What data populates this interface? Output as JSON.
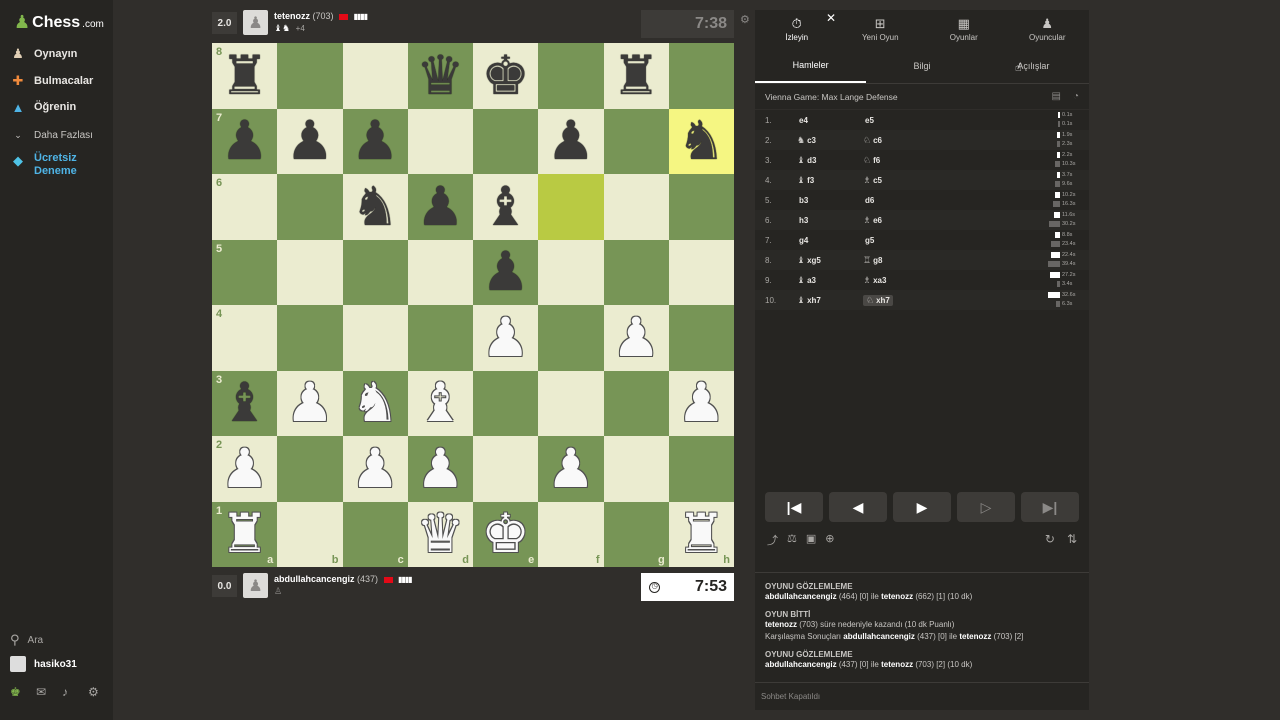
{
  "sidebar": {
    "logo_text": "Chess",
    "logo_domain": ".com",
    "items": [
      {
        "label": "Oynayın"
      },
      {
        "label": "Bulmacalar"
      },
      {
        "label": "Öğrenin"
      },
      {
        "label": "Daha Fazlası"
      },
      {
        "label": "Ücretsiz Deneme"
      }
    ],
    "search_label": "Ara",
    "username": "hasiko31"
  },
  "top_player": {
    "score": "2.0",
    "name": "tetenozz",
    "rating": "(703)",
    "advantage": "+4"
  },
  "bottom_player": {
    "score": "0.0",
    "name": "abdullahcancengiz",
    "rating": "(437)"
  },
  "clocks": {
    "top": "7:38",
    "bottom": "7:53"
  },
  "board": {
    "ranks": [
      "8",
      "7",
      "6",
      "5",
      "4",
      "3",
      "2",
      "1"
    ],
    "files": [
      "a",
      "b",
      "c",
      "d",
      "e",
      "f",
      "g",
      "h"
    ],
    "position": [
      [
        "bR",
        "",
        "",
        "bQ",
        "bK",
        "",
        "bR",
        ""
      ],
      [
        "bP",
        "bP",
        "bP",
        "",
        "",
        "bP",
        "",
        "bN"
      ],
      [
        "",
        "",
        "bN",
        "bP",
        "bB",
        "",
        "",
        ""
      ],
      [
        "",
        "",
        "",
        "",
        "bP",
        "",
        "",
        ""
      ],
      [
        "",
        "",
        "",
        "",
        "wP",
        "",
        "wP",
        ""
      ],
      [
        "bB",
        "wP",
        "wN",
        "wB",
        "",
        "",
        "",
        "wP"
      ],
      [
        "wP",
        "",
        "wP",
        "wP",
        "",
        "wP",
        "",
        ""
      ],
      [
        "wR",
        "",
        "",
        "wQ",
        "wK",
        "",
        "",
        "wR"
      ]
    ],
    "highlight": [
      "f6",
      "h7"
    ]
  },
  "panel": {
    "tabs": [
      {
        "label": "İzleyin",
        "icon": "stopwatch-icon"
      },
      {
        "label": "Yeni Oyun",
        "icon": "plus-square-icon"
      },
      {
        "label": "Oyunlar",
        "icon": "board-icon"
      },
      {
        "label": "Oyuncular",
        "icon": "players-icon"
      }
    ],
    "subtabs": [
      "Hamleler",
      "Bilgi",
      "Açılışlar"
    ],
    "opening": "Vienna Game: Max Lange Defense",
    "moves": [
      {
        "n": "1.",
        "w": "e4",
        "wp": "",
        "b": "e5",
        "bp": "",
        "wt": "0.1s",
        "bt": "0.1s",
        "wr": 0.02,
        "br": 0.02
      },
      {
        "n": "2.",
        "w": "c3",
        "wp": "♞",
        "b": "c6",
        "bp": "♘",
        "wt": "1.9s",
        "bt": "2.3s",
        "wr": 0.06,
        "br": 0.07
      },
      {
        "n": "3.",
        "w": "d3",
        "wp": "♝",
        "b": "f6",
        "bp": "♘",
        "wt": "2.2s",
        "bt": "10.3s",
        "wr": 0.07,
        "br": 0.32
      },
      {
        "n": "4.",
        "w": "f3",
        "wp": "♝",
        "b": "c5",
        "bp": "♗",
        "wt": "3.7s",
        "bt": "9.6s",
        "wr": 0.11,
        "br": 0.29
      },
      {
        "n": "5.",
        "w": "b3",
        "wp": "",
        "b": "d6",
        "bp": "",
        "wt": "10.2s",
        "bt": "16.3s",
        "wr": 0.31,
        "br": 0.5
      },
      {
        "n": "6.",
        "w": "h3",
        "wp": "",
        "b": "e6",
        "bp": "♗",
        "wt": "11.6s",
        "bt": "30.2s",
        "wr": 0.36,
        "br": 0.92
      },
      {
        "n": "7.",
        "w": "g4",
        "wp": "",
        "b": "g5",
        "bp": "",
        "wt": "8.8s",
        "bt": "23.4s",
        "wr": 0.27,
        "br": 0.72
      },
      {
        "n": "8.",
        "w": "xg5",
        "wp": "♝",
        "b": "g8",
        "bp": "♖",
        "wt": "22.4s",
        "bt": "39.4s",
        "wr": 0.69,
        "br": 1.0
      },
      {
        "n": "9.",
        "w": "a3",
        "wp": "♝",
        "b": "xa3",
        "bp": "♗",
        "wt": "27.2s",
        "bt": "3.4s",
        "wr": 0.83,
        "br": 0.1
      },
      {
        "n": "10.",
        "w": "xh7",
        "wp": "♝",
        "b": "xh7",
        "bp": "♘",
        "wt": "32.6s",
        "bt": "6.3s",
        "wr": 1.0,
        "br": 0.19
      }
    ],
    "chat": {
      "h1": "OYUNU GÖZLEMLEME",
      "l1_name1": "abdullahcancengiz",
      "l1_mid": "(464) [0] ile",
      "l1_name2": "tetenozz",
      "l1_end": "(662) [1] (10 dk)",
      "h2": "OYUN BİTTİ",
      "l2_name": "tetenozz",
      "l2_rest": "(703) süre nedeniyle kazandı (10 dk Puanlı)",
      "l3_pre": "Karşılaşma Sonuçları",
      "l3_name1": "abdullahcancengiz",
      "l3_mid": "(437) [0] ile",
      "l3_name2": "tetenozz",
      "l3_end": "(703) [2]",
      "h3": "OYUNU GÖZLEMLEME",
      "l4_name1": "abdullahcancengiz",
      "l4_mid": "(437) [0] ile",
      "l4_name2": "tetenozz",
      "l4_end": "(703) [2] (10 dk)",
      "placeholder": "Sohbet Kapatıldı"
    }
  }
}
